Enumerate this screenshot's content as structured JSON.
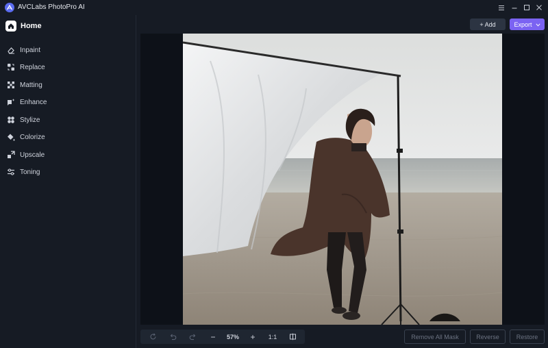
{
  "app": {
    "title": "AVCLabs PhotoPro AI",
    "logo_icon": "avclabs-logo-icon"
  },
  "window_controls": [
    "menu-icon",
    "minimize-icon",
    "maximize-icon",
    "close-icon"
  ],
  "sidebar": {
    "home": {
      "label": "Home",
      "icon": "home-icon"
    },
    "items": [
      {
        "label": "Inpaint",
        "icon": "eraser-icon"
      },
      {
        "label": "Replace",
        "icon": "replace-icon"
      },
      {
        "label": "Matting",
        "icon": "matting-icon"
      },
      {
        "label": "Enhance",
        "icon": "enhance-icon"
      },
      {
        "label": "Stylize",
        "icon": "stylize-icon"
      },
      {
        "label": "Colorize",
        "icon": "colorize-icon"
      },
      {
        "label": "Upscale",
        "icon": "upscale-icon"
      },
      {
        "label": "Toning",
        "icon": "toning-icon"
      }
    ]
  },
  "header": {
    "add_label": "+ Add",
    "export_label": "Export"
  },
  "zoom_toolbar": {
    "zoom_level": "57%",
    "ratio_label": "1:1",
    "minus": "−",
    "plus": "+"
  },
  "actions": {
    "remove_all_mask": "Remove All Mask",
    "reverse": "Reverse",
    "restore": "Restore"
  },
  "colors": {
    "accent": "#7b63f2",
    "background": "#161b24",
    "canvas": "#0d1118"
  }
}
